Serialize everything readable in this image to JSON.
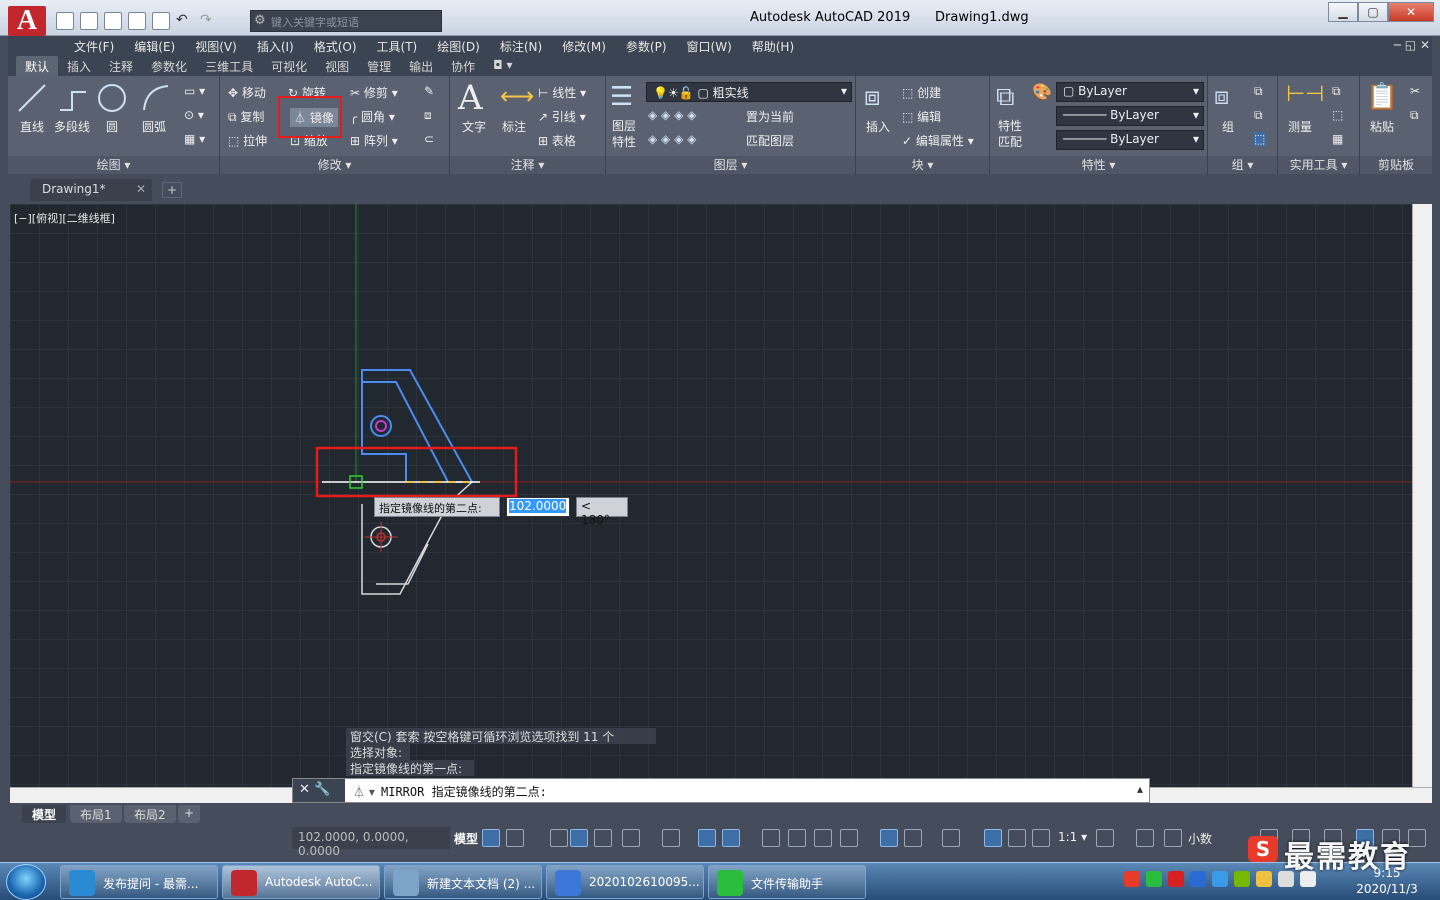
{
  "titlebar": {
    "app_title": "Autodesk AutoCAD 2019",
    "doc_title": "Drawing1.dwg",
    "search_placeholder": "键入关键字或短语",
    "logo_letter": "A"
  },
  "menubar": [
    "文件(F)",
    "编辑(E)",
    "视图(V)",
    "插入(I)",
    "格式(O)",
    "工具(T)",
    "绘图(D)",
    "标注(N)",
    "修改(M)",
    "参数(P)",
    "窗口(W)",
    "帮助(H)"
  ],
  "ribbon_tabs": [
    {
      "label": "默认",
      "active": true
    },
    {
      "label": "插入"
    },
    {
      "label": "注释"
    },
    {
      "label": "参数化"
    },
    {
      "label": "三维工具"
    },
    {
      "label": "可视化"
    },
    {
      "label": "视图"
    },
    {
      "label": "管理"
    },
    {
      "label": "输出"
    },
    {
      "label": "协作"
    }
  ],
  "ribbon": {
    "draw": {
      "title": "绘图",
      "line": "直线",
      "polyline": "多段线",
      "circle": "圆",
      "arc": "圆弧"
    },
    "modify": {
      "title": "修改",
      "move": "移动",
      "rotate": "旋转",
      "trim": "修剪",
      "copy": "复制",
      "mirror": "镜像",
      "fillet": "圆角",
      "stretch": "拉伸",
      "scale": "缩放",
      "array": "阵列"
    },
    "annotation": {
      "title": "注释",
      "text": "文字",
      "dimension": "标注",
      "linear": "线性",
      "leader": "引线",
      "table": "表格"
    },
    "layers": {
      "title": "图层",
      "layer_props": "图层特性",
      "current_layer": "粗实线",
      "make_current": "置为当前",
      "match_layer": "匹配图层"
    },
    "block": {
      "title": "块",
      "insert": "插入",
      "create": "创建",
      "edit": "编辑",
      "edit_attr": "编辑属性"
    },
    "properties": {
      "title": "特性",
      "match": "特性匹配",
      "color": "ByLayer",
      "linetype": "ByLayer",
      "lineweight": "ByLayer"
    },
    "groups": {
      "title": "组",
      "group": "组"
    },
    "utilities": {
      "title": "实用工具",
      "measure": "测量"
    },
    "clipboard": {
      "title": "剪贴板",
      "paste": "粘贴"
    }
  },
  "doc_tab": "Drawing1*",
  "viewport_label": "[−][俯视][二维线框]",
  "dynamic_input": {
    "prompt": "指定镜像线的第二点:",
    "distance": "102.0000",
    "angle": "< 180°"
  },
  "command_history": [
    "窗交(C) 套索  按空格键可循环浏览选项找到 11 个",
    "选择对象:",
    "指定镜像线的第一点:"
  ],
  "command_line": "MIRROR 指定镜像线的第二点:",
  "layout_tabs": [
    {
      "label": "模型",
      "active": true
    },
    {
      "label": "布局1"
    },
    {
      "label": "布局2"
    }
  ],
  "status": {
    "coords": "102.0000, 0.0000, 0.0000",
    "model": "模型",
    "scale": "1:1",
    "units": "小数"
  },
  "taskbar": [
    {
      "label": "发布提问 - 最需...",
      "icon": "ie-icon",
      "color": "#2a8ad4"
    },
    {
      "label": "Autodesk AutoC...",
      "icon": "autocad-icon",
      "color": "#c1272d",
      "active": true
    },
    {
      "label": "新建文本文档 (2) ...",
      "icon": "notepad-icon",
      "color": "#7da3c9"
    },
    {
      "label": "2020102610095...",
      "icon": "vs-icon",
      "color": "#3c78d8"
    },
    {
      "label": "文件传输助手",
      "icon": "wechat-icon",
      "color": "#2bbd3c"
    }
  ],
  "clock": {
    "time": "9:15",
    "date": "2020/11/3"
  },
  "watermark": "最需教育",
  "highlight_color": "#e81b1b"
}
